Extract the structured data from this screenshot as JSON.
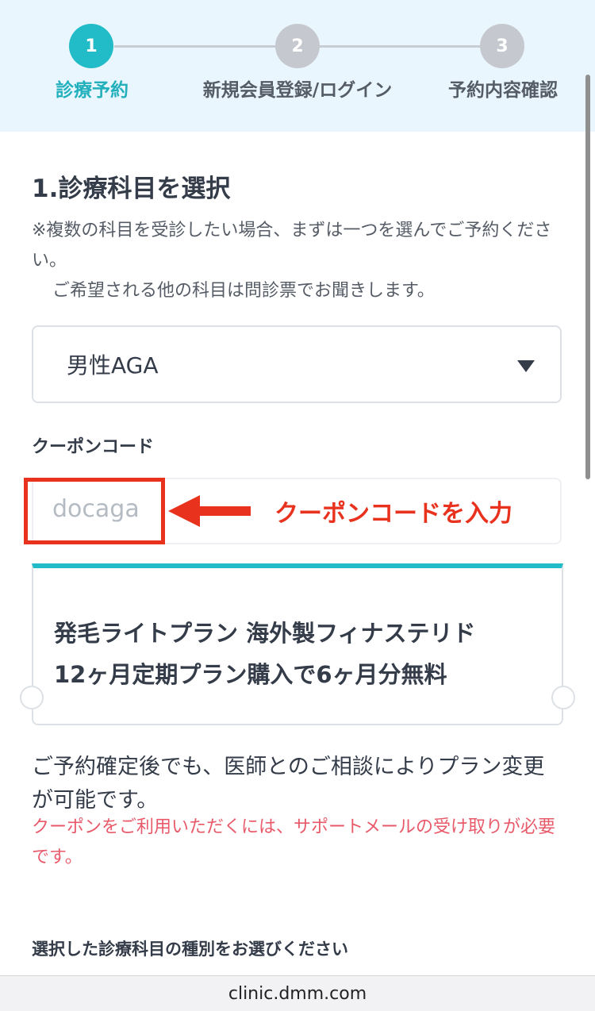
{
  "stepper": {
    "steps": [
      {
        "number": "1",
        "label": "診療予約"
      },
      {
        "number": "2",
        "label": "新規会員登録/ログイン"
      },
      {
        "number": "3",
        "label": "予約内容確認"
      }
    ],
    "active_color": "#22bcc8",
    "inactive_color": "#c6c8cf"
  },
  "section": {
    "title": "1.診療科目を選択",
    "note_line1": "※複数の科目を受診したい場合、まずは一つを選んでご予約ください。",
    "note_line2": "ご希望される他の科目は問診票でお聞きします。"
  },
  "select": {
    "value": "男性AGA",
    "icon": "caret-down-icon"
  },
  "coupon": {
    "label": "クーポンコード",
    "value": "docaga",
    "annotation": "クーポンコードを入力",
    "annotation_color": "#e8321e"
  },
  "plan": {
    "line1": "発毛ライトプラン 海外製フィナステリド",
    "line2": "12ヶ月定期プラン購入で6ヶ月分無料",
    "accent_color": "#22bcc8"
  },
  "info": {
    "text": "ご予約確定後でも、医師とのご相談によりプラン変更が可能です。",
    "warning": "クーポンをご利用いただくには、サポートメールの受け取りが必要です。",
    "warning_color": "#e85a6a"
  },
  "subheading": "選択した診療科目の種別をお選びください",
  "browser": {
    "url": "clinic.dmm.com"
  }
}
